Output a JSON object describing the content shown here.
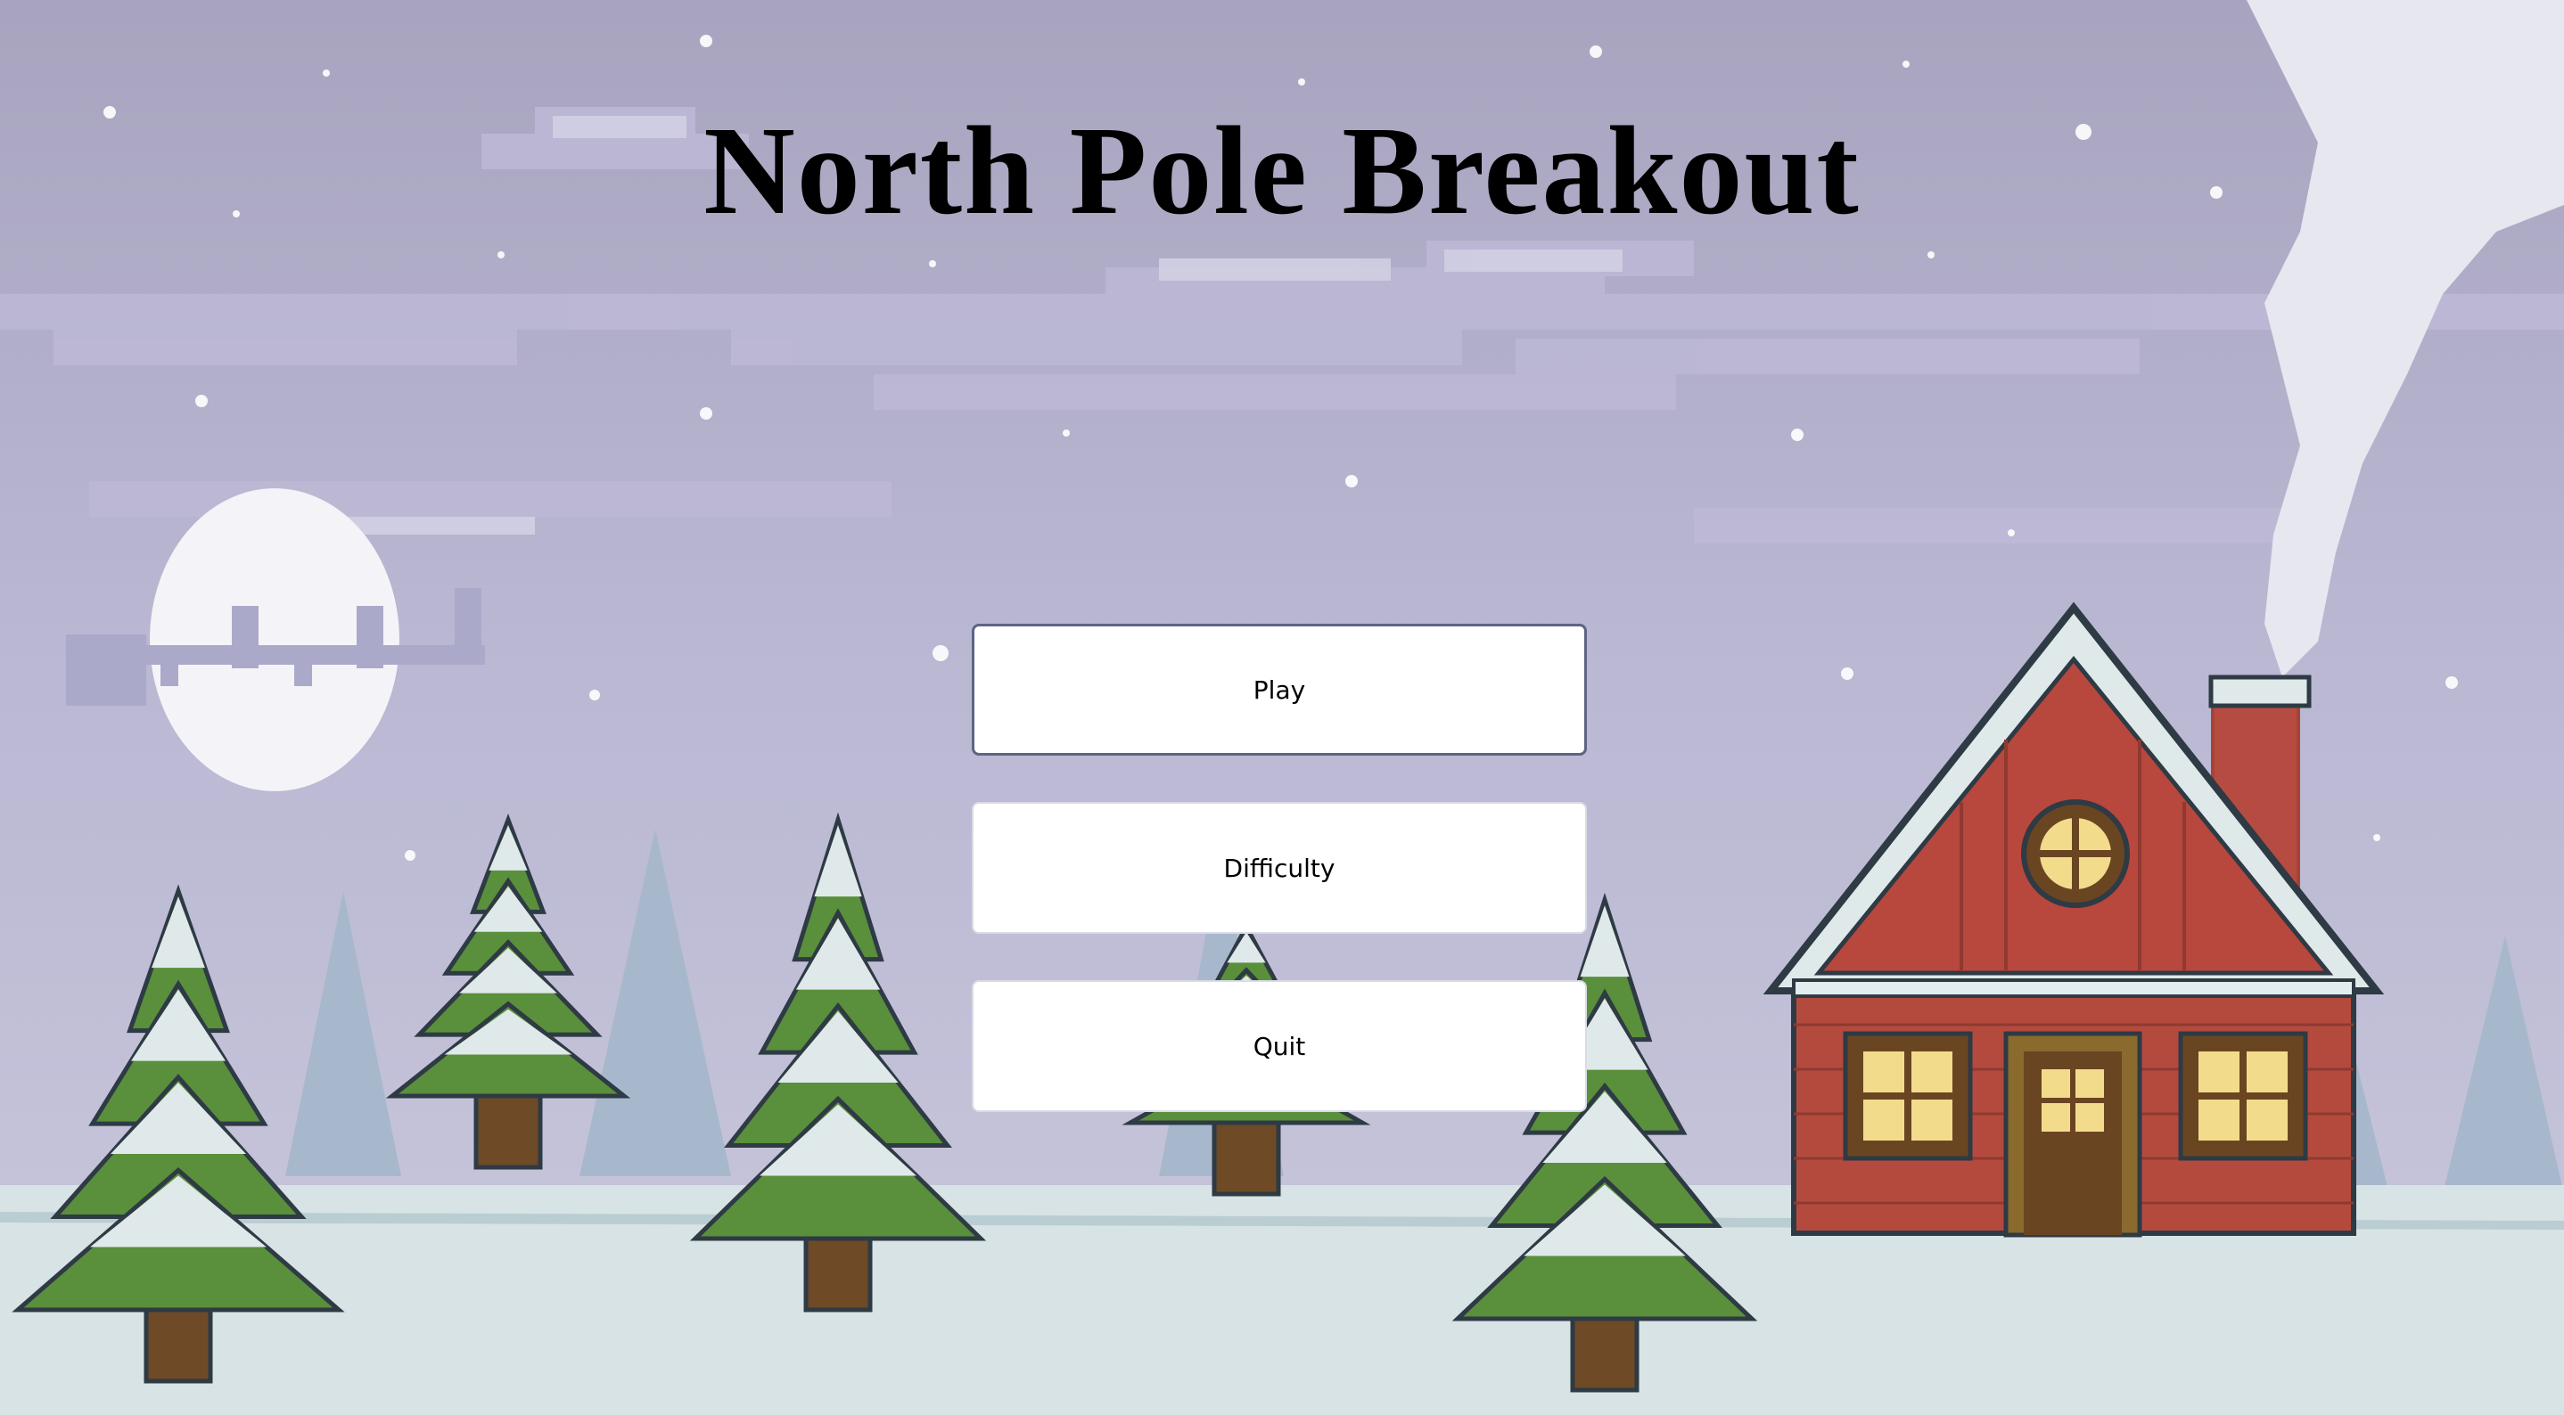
{
  "game": {
    "title": "North Pole Breakout"
  },
  "menu": {
    "items": [
      {
        "label": "Play",
        "focused": true
      },
      {
        "label": "Difficulty",
        "focused": false
      },
      {
        "label": "Quit",
        "focused": false
      }
    ]
  },
  "colors": {
    "sky_top": "#a9a5c1",
    "sky_bottom": "#c7c6dc",
    "cloud": "#bdb9d6",
    "snow_ground": "#d9e4e6",
    "tree_green": "#5a8f3c",
    "tree_snow": "#dfe9ea",
    "trunk": "#6e4a27",
    "house_wall": "#b64c41",
    "house_roof": "#b8473d",
    "window_light": "#f2dc8c",
    "moon": "#f3f2f8",
    "smoke": "#e3e4ee",
    "button_bg": "#ffffff",
    "button_focus_border": "#5d6583"
  },
  "icons": [
    "moon-icon",
    "sleigh-silhouette-icon",
    "snowflake-icon",
    "pine-tree-icon",
    "cabin-icon",
    "chimney-smoke-icon"
  ]
}
